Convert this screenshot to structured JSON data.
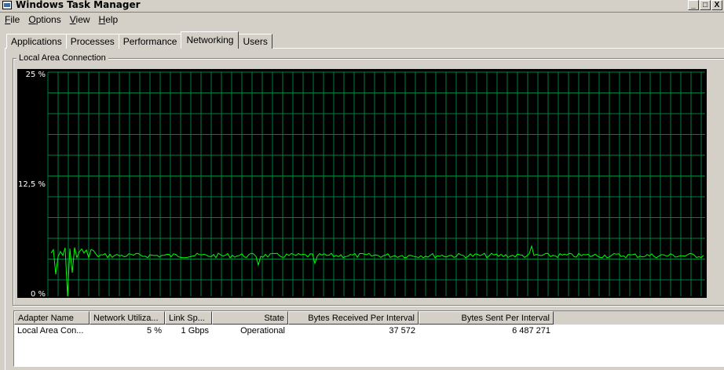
{
  "window": {
    "title": "Windows Task Manager",
    "buttons": [
      "_",
      "□",
      "X"
    ]
  },
  "menu": [
    {
      "label": "File",
      "accel": "F",
      "rest": "ile"
    },
    {
      "label": "Options",
      "accel": "O",
      "rest": "ptions"
    },
    {
      "label": "View",
      "accel": "V",
      "rest": "iew"
    },
    {
      "label": "Help",
      "accel": "H",
      "rest": "elp"
    }
  ],
  "tabs": [
    "Applications",
    "Processes",
    "Performance",
    "Networking",
    "Users"
  ],
  "active_tab": "Networking",
  "group": {
    "label": "Local Area Connection"
  },
  "graph": {
    "labels": {
      "top": "25 %",
      "mid": "12,5 %",
      "bottom": "0 %"
    },
    "colors": {
      "background": "#000000",
      "grid": "#008040",
      "line": "#00ff00"
    }
  },
  "table": {
    "headers": [
      "Adapter Name",
      "Network Utiliza...",
      "Link Sp...",
      "State",
      "Bytes Received Per Interval",
      "Bytes Sent Per Interval"
    ],
    "rows": [
      [
        "Local Area Con...",
        "5 %",
        "1 Gbps",
        "Operational",
        "37 572",
        "6 487 271"
      ]
    ]
  }
}
